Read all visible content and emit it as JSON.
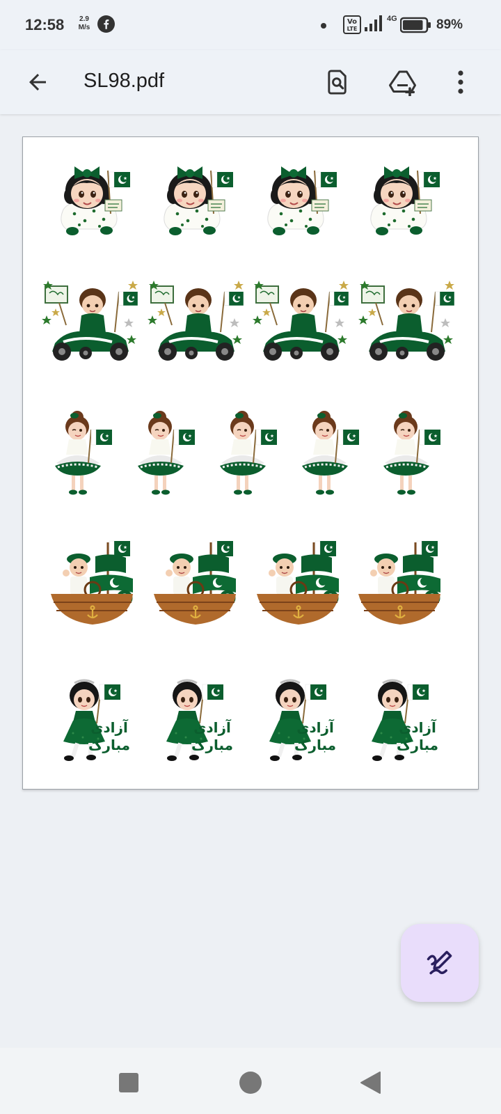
{
  "status_bar": {
    "time": "12:58",
    "speed_value": "2.9",
    "speed_unit": "M/s",
    "network_type": "4G",
    "volte_label_line1": "Vo",
    "volte_label_line2": "LTE",
    "battery": "89%",
    "battery_level": 0.89,
    "icons": [
      "facebook-icon",
      "notification-dot",
      "volte-icon",
      "signal-icon",
      "battery-icon"
    ]
  },
  "app_bar": {
    "title": "SL98.pdf",
    "actions": [
      "back-icon",
      "find-in-document-icon",
      "add-to-drive-icon",
      "more-vert-icon"
    ]
  },
  "document": {
    "sticker_rows": [
      {
        "subject": "baby girl with green bow holding flag",
        "count": 4,
        "sign_text": "Azadi Mubarak"
      },
      {
        "subject": "boy in green race car with banner",
        "count": 4
      },
      {
        "subject": "girl in white and green tutu dress with flag",
        "count": 5
      },
      {
        "subject": "boy on wooden ship with crescent sail",
        "count": 4
      },
      {
        "subject": "girl in green dress with flag",
        "count": 4,
        "caption_line1": "آزادی",
        "caption_line2": "مبارک"
      }
    ]
  },
  "fab": {
    "icon": "edit-annotate-icon"
  },
  "nav_bar": {
    "buttons": [
      "recents-square-icon",
      "home-circle-icon",
      "back-triangle-icon"
    ]
  },
  "colors": {
    "flag_green": "#0b5e2e",
    "accent": "#e9ddfb",
    "fab_icon": "#2a1f5e",
    "wood": "#b06a2c"
  }
}
